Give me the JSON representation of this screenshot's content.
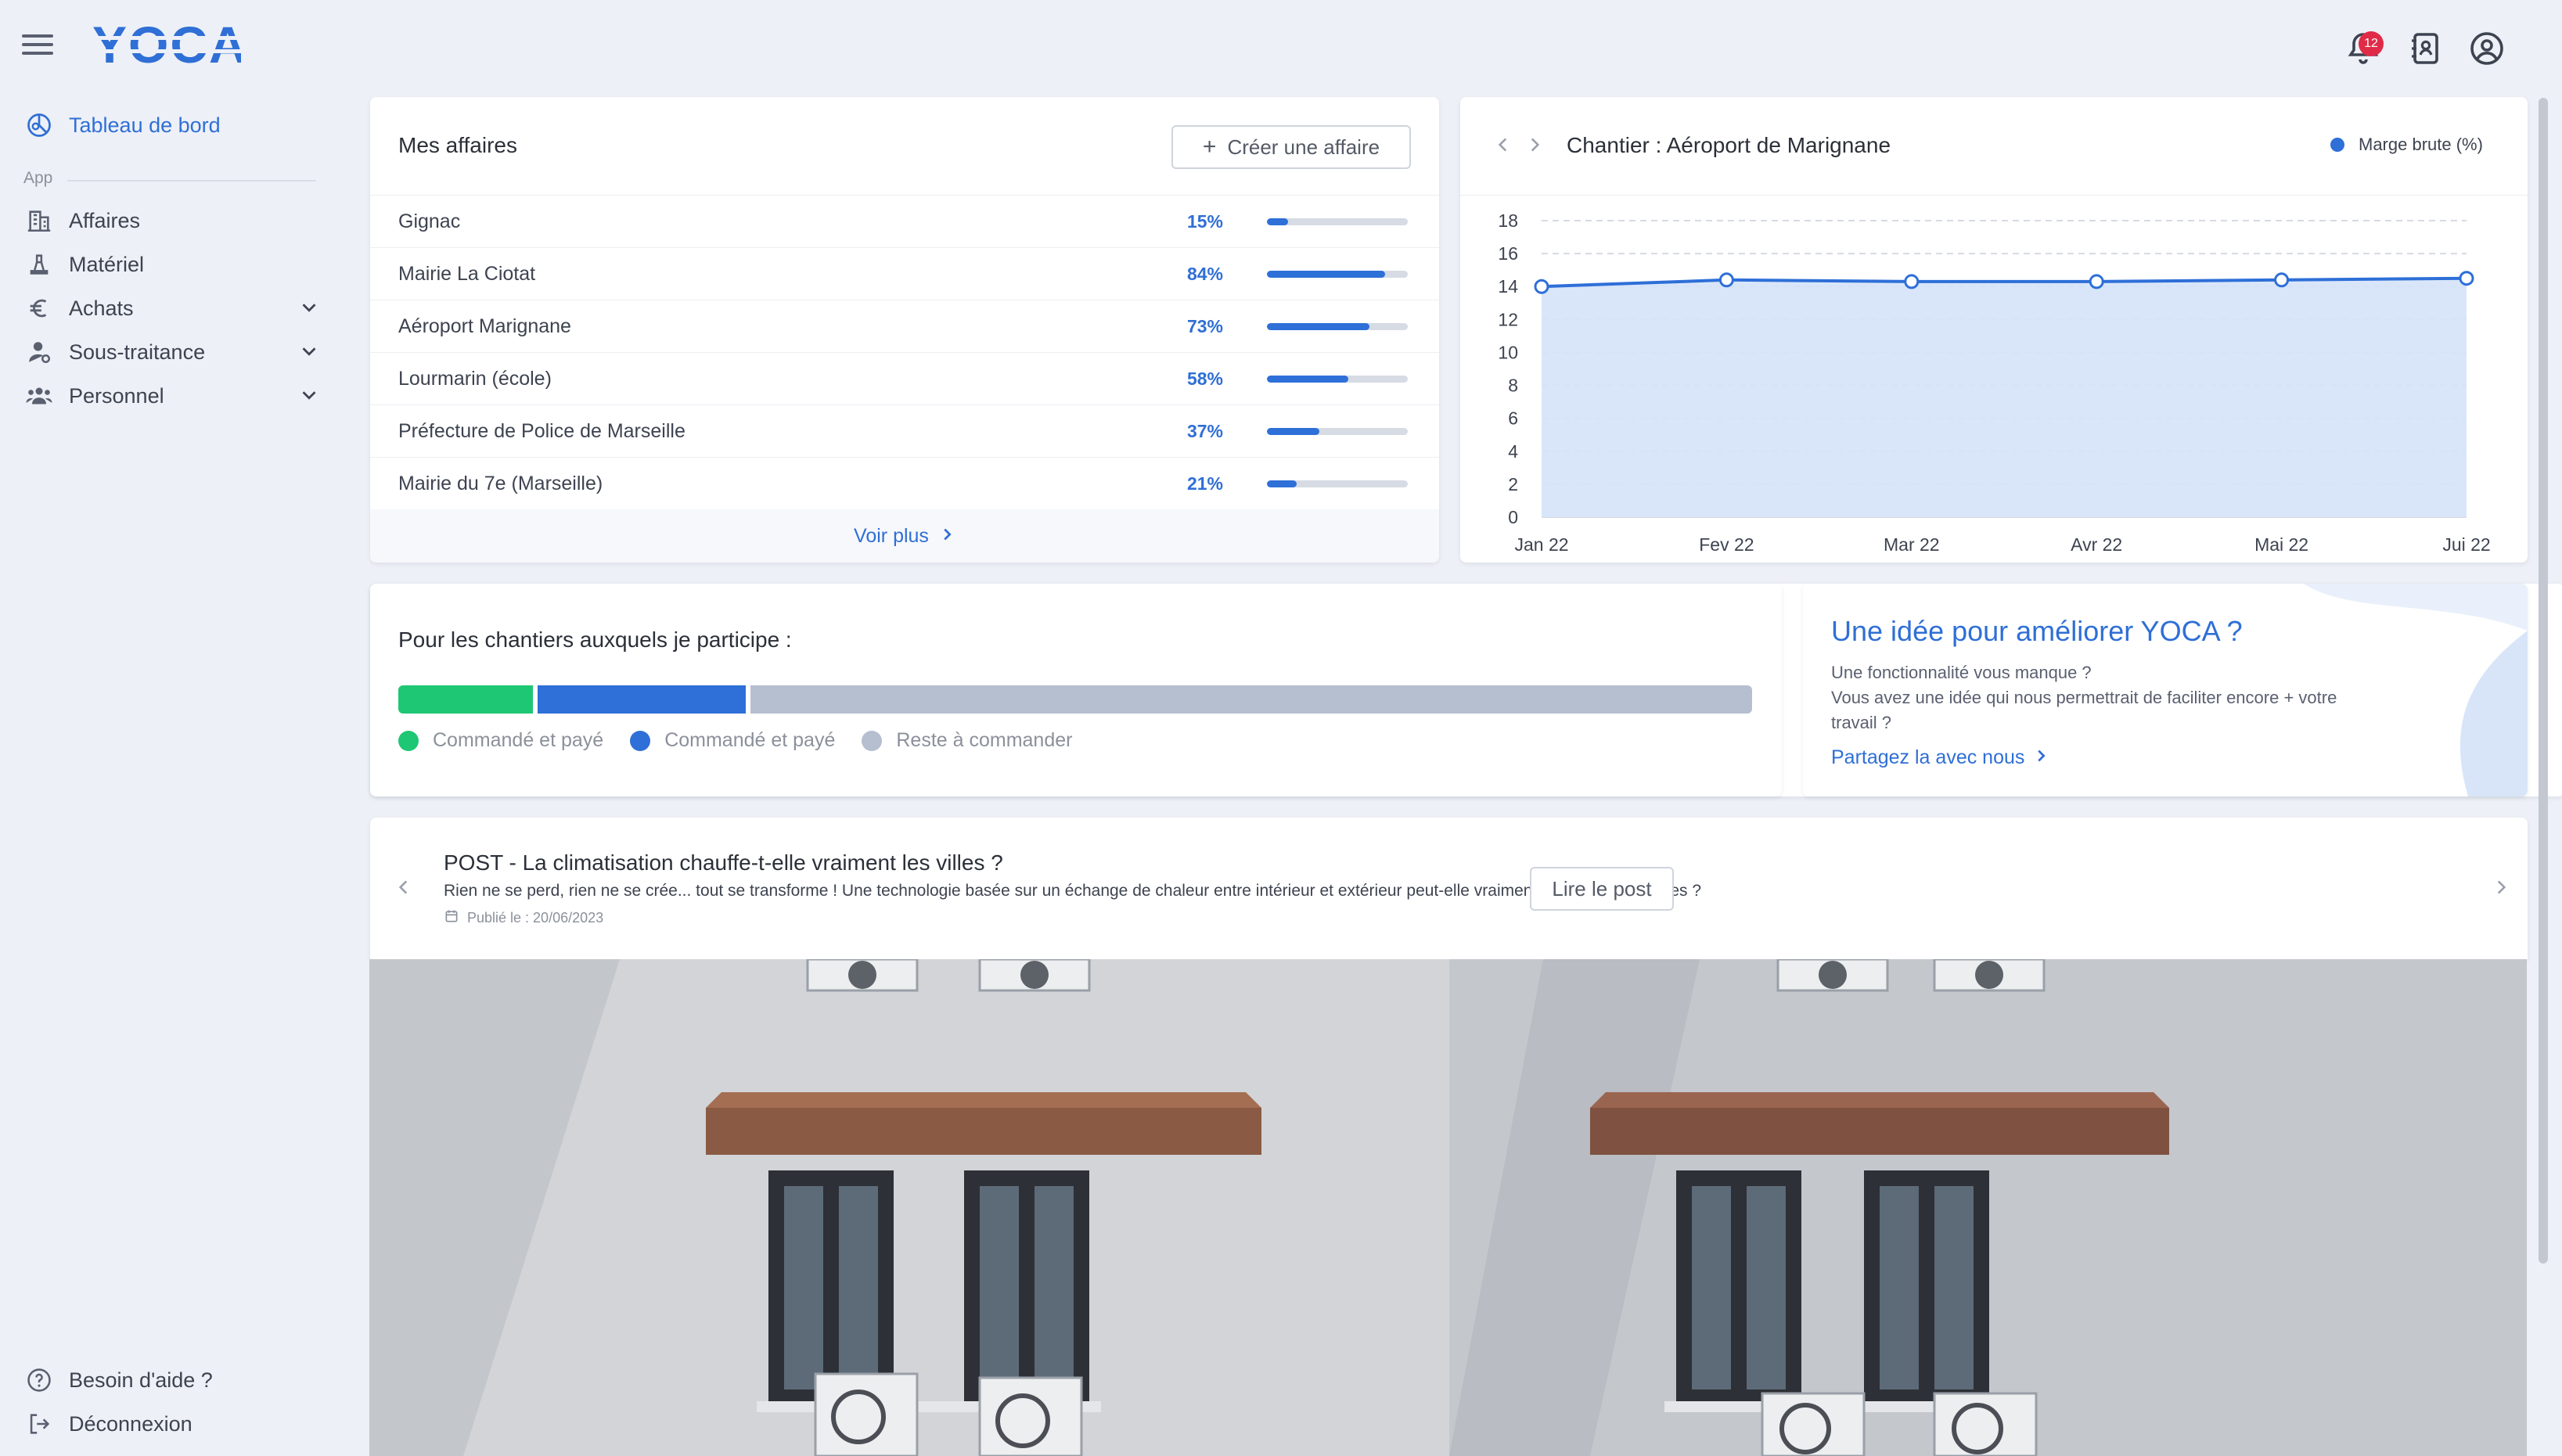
{
  "header": {
    "logo_text": "YOCA",
    "notification_count": "12"
  },
  "sidebar": {
    "dashboard_label": "Tableau de bord",
    "section_label": "App",
    "items": [
      {
        "label": "Affaires",
        "icon": "building-icon"
      },
      {
        "label": "Matériel",
        "icon": "tool-icon"
      },
      {
        "label": "Achats",
        "icon": "euro-icon"
      },
      {
        "label": "Sous-traitance",
        "icon": "person-icon"
      },
      {
        "label": "Personnel",
        "icon": "people-icon"
      }
    ],
    "help_label": "Besoin d'aide ?",
    "logout_label": "Déconnexion"
  },
  "affaires": {
    "title": "Mes affaires",
    "create_label": "Créer une affaire",
    "rows": [
      {
        "name": "Gignac",
        "pct_label": "15%",
        "pct": 15
      },
      {
        "name": "Mairie La Ciotat",
        "pct_label": "84%",
        "pct": 84
      },
      {
        "name": "Aéroport Marignane",
        "pct_label": "73%",
        "pct": 73
      },
      {
        "name": "Lourmarin (école)",
        "pct_label": "58%",
        "pct": 58
      },
      {
        "name": "Préfecture de Police de Marseille",
        "pct_label": "37%",
        "pct": 37
      },
      {
        "name": "Mairie du 7e (Marseille)",
        "pct_label": "21%",
        "pct": 21
      }
    ],
    "more_label": "Voir plus"
  },
  "chantier": {
    "title": "Chantier : Aéroport de Marignane",
    "legend_label": "Marge brute (%)",
    "colors": {
      "line": "#2e6fd8",
      "area": "#d5e3f8"
    }
  },
  "chart_data": {
    "type": "area",
    "categories": [
      "Jan 22",
      "Fev 22",
      "Mar 22",
      "Avr 22",
      "Mai 22",
      "Jui 22"
    ],
    "series": [
      {
        "name": "Marge brute (%)",
        "values": [
          14.0,
          14.4,
          14.3,
          14.3,
          14.4,
          14.5
        ]
      }
    ],
    "ylim": [
      0,
      18
    ],
    "yticks": [
      0,
      2,
      4,
      6,
      8,
      10,
      12,
      14,
      16,
      18
    ],
    "grid": true,
    "legend": "top-right"
  },
  "participation": {
    "title": "Pour les chantiers auxquels je participe :",
    "segments": [
      {
        "label": "Commandé et payé",
        "share": 10,
        "color": "#1ec773"
      },
      {
        "label": "Commandé et payé",
        "share": 15.5,
        "color": "#2e6fd8"
      },
      {
        "label": "Reste à commander",
        "share": 74.5,
        "color": "#b6bfcf"
      }
    ]
  },
  "idea": {
    "title": "Une idée pour améliorer YOCA ?",
    "line1": "Une fonctionnalité vous manque ?",
    "line2": "Vous avez une idée qui nous permettrait de faciliter encore + votre",
    "line3": "travail ?",
    "link_label": "Partagez la avec nous"
  },
  "post": {
    "title": "POST - La climatisation chauffe-t-elle vraiment les villes ?",
    "excerpt": "Rien ne se perd, rien ne se crée... tout se transforme ! Une technologie basée sur un échange de chaleur entre intérieur et extérieur peut-elle vraiment réchauffer nos villes ?",
    "date": "Publié le : 20/06/2023",
    "read_label": "Lire le post"
  }
}
